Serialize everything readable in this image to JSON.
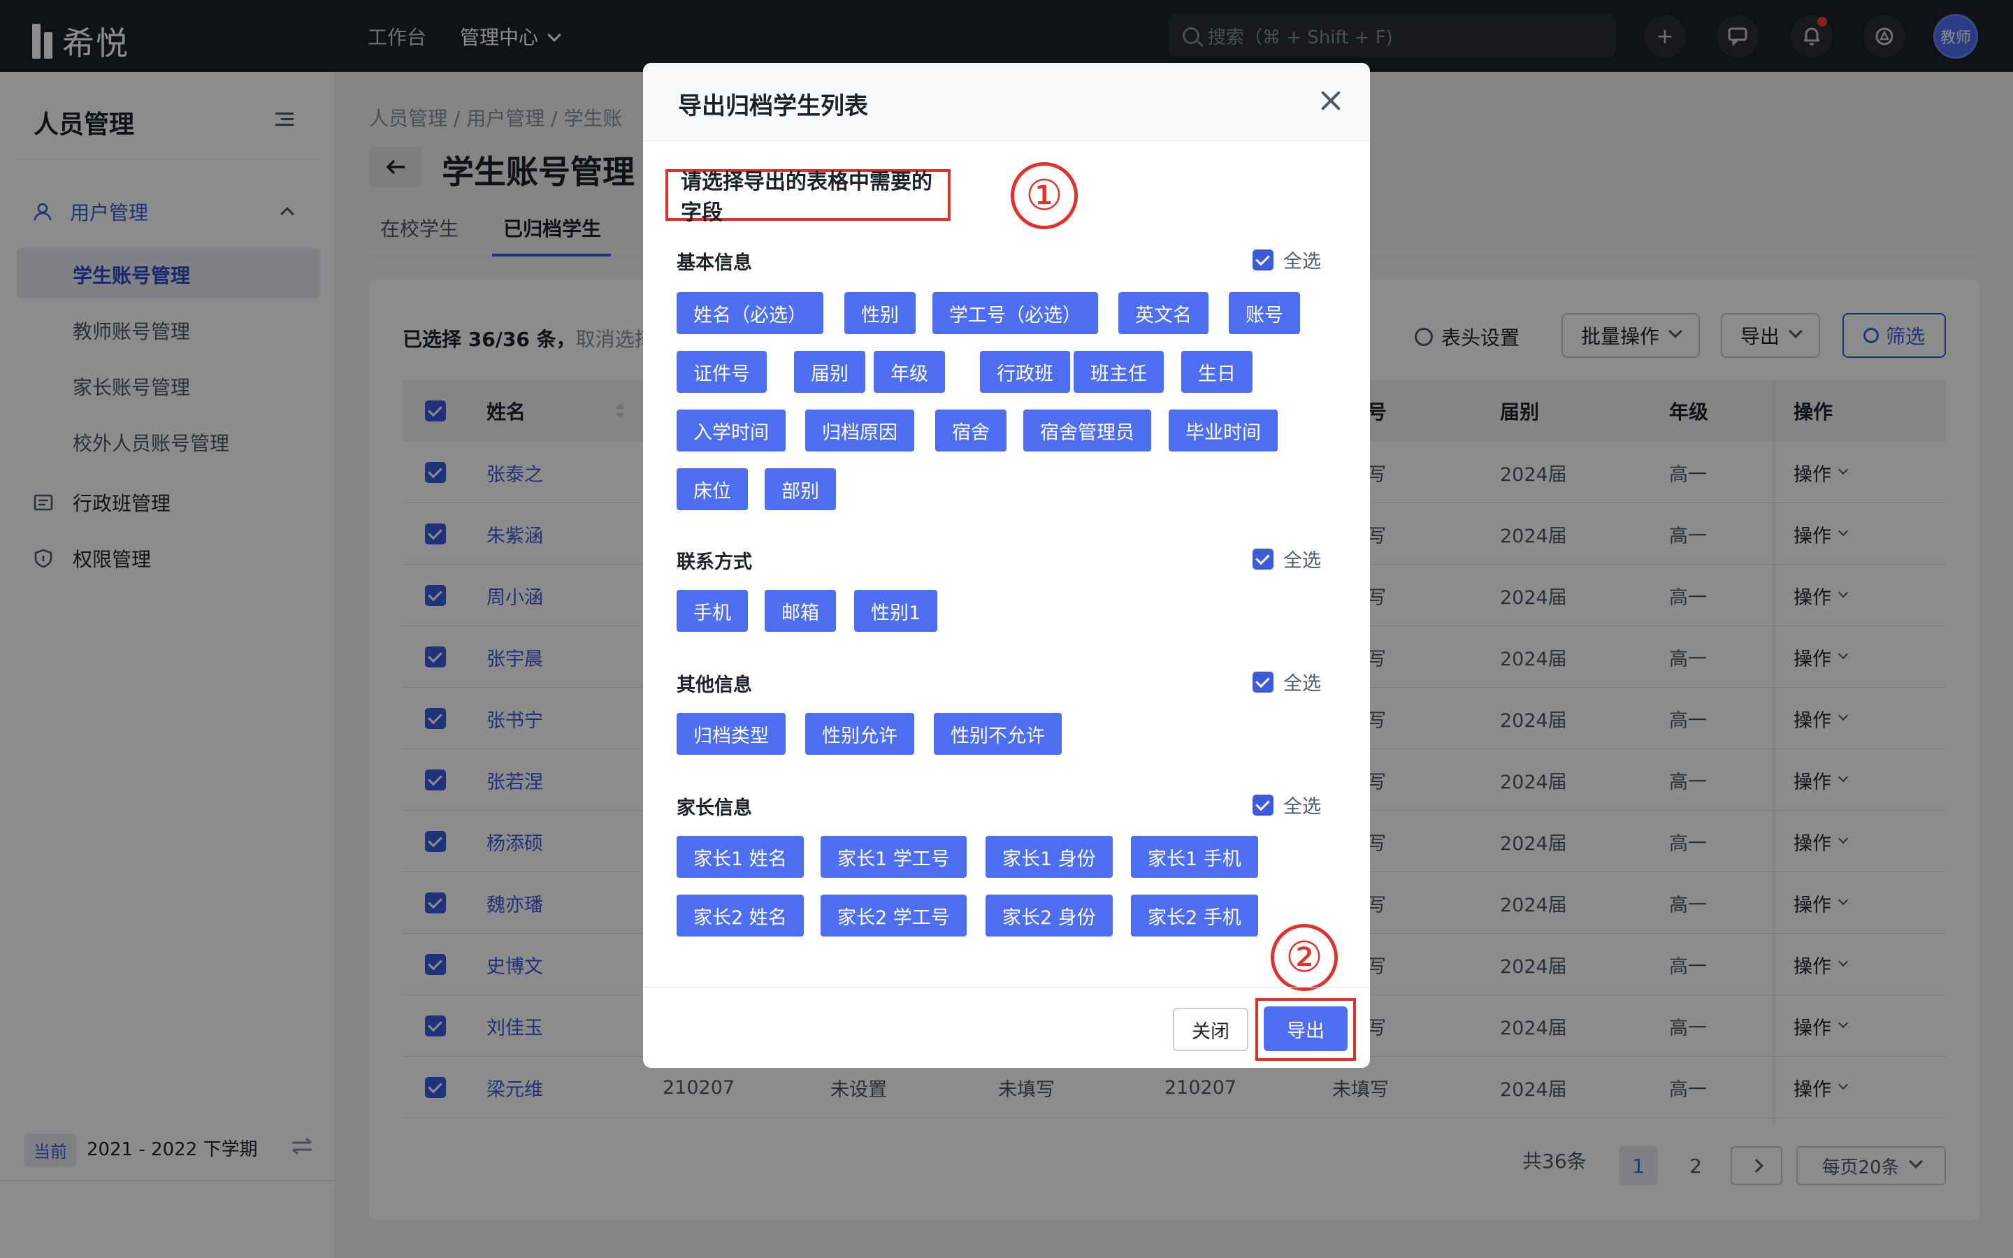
{
  "app": {
    "logo_text": "希悦"
  },
  "topnav": {
    "workbench": "工作台",
    "admin_center": "管理中心"
  },
  "search": {
    "placeholder": "搜索（⌘ + Shift + F)"
  },
  "header": {
    "avatar_label": "教师"
  },
  "sidebar": {
    "title": "人员管理",
    "group_label": "用户管理",
    "items": [
      {
        "label": "学生账号管理",
        "active": true
      },
      {
        "label": "教师账号管理"
      },
      {
        "label": "家长账号管理"
      },
      {
        "label": "校外人员账号管理"
      }
    ],
    "menus": [
      {
        "label": "行政班管理"
      },
      {
        "label": "权限管理"
      }
    ],
    "term_tag": "当前",
    "term": "2021 - 2022 下学期"
  },
  "main": {
    "breadcrumb": "人员管理  /  用户管理  /  学生账",
    "title": "学生账号管理",
    "tabs": [
      {
        "label": "在校学生"
      },
      {
        "label": "已归档学生"
      }
    ],
    "selection": "已选择 36/36 条，",
    "cancel_selection": "取消选择",
    "header_settings": "表头设置",
    "batch_ops": "批量操作",
    "export": "导出",
    "filter": "筛选"
  },
  "table": {
    "headers": {
      "name": "姓名",
      "id": "号",
      "cohort": "届别",
      "grade": "年级",
      "ops": "操作"
    },
    "rows": [
      {
        "name": "张泰之",
        "id_tail": "写",
        "cohort": "2024届",
        "grade": "高一",
        "op": "操作"
      },
      {
        "name": "朱紫涵",
        "id_tail": "写",
        "cohort": "2024届",
        "grade": "高一",
        "op": "操作"
      },
      {
        "name": "周小涵",
        "id_tail": "写",
        "cohort": "2024届",
        "grade": "高一",
        "op": "操作"
      },
      {
        "name": "张宇晨",
        "id_tail": "写",
        "cohort": "2024届",
        "grade": "高一",
        "op": "操作"
      },
      {
        "name": "张书宁",
        "id_tail": "写",
        "cohort": "2024届",
        "grade": "高一",
        "op": "操作"
      },
      {
        "name": "张若涅",
        "id_tail": "写",
        "cohort": "2024届",
        "grade": "高一",
        "op": "操作"
      },
      {
        "name": "杨添硕",
        "id_tail": "写",
        "cohort": "2024届",
        "grade": "高一",
        "op": "操作"
      },
      {
        "name": "魏亦璠",
        "id_tail": "写",
        "cohort": "2024届",
        "grade": "高一",
        "op": "操作"
      },
      {
        "name": "史博文",
        "id_tail": "写",
        "cohort": "2024届",
        "grade": "高一",
        "op": "操作"
      },
      {
        "name": "刘佳玉",
        "id_tail": "写",
        "cohort": "2024届",
        "grade": "高一",
        "op": "操作"
      }
    ],
    "last_row": {
      "name": "梁元维",
      "c1": "210207",
      "c2": "未设置",
      "c3": "未填写",
      "c4": "210207",
      "c5": "未填写",
      "cohort": "2024届",
      "grade": "高一",
      "op": "操作"
    }
  },
  "pager": {
    "total": "共36条",
    "page1": "1",
    "page2": "2",
    "page_size": "每页20条"
  },
  "modal": {
    "title": "导出归档学生列表",
    "instruction": "请选择导出的表格中需要的字段",
    "marker1": "①",
    "marker2": "②",
    "select_all": "全选",
    "sections": {
      "basic": {
        "title": "基本信息",
        "tags": [
          "姓名（必选）",
          "性别",
          "学工号（必选）",
          "英文名",
          "账号",
          "证件号",
          "届别",
          "年级",
          "行政班",
          "班主任",
          "生日",
          "入学时间",
          "归档原因",
          "宿舍",
          "宿舍管理员",
          "毕业时间",
          "床位",
          "部别"
        ]
      },
      "contact": {
        "title": "联系方式",
        "tags": [
          "手机",
          "邮箱",
          "性别1"
        ]
      },
      "other": {
        "title": "其他信息",
        "tags": [
          "归档类型",
          "性别允许",
          "性别不允许"
        ]
      },
      "parent": {
        "title": "家长信息",
        "tags": [
          "家长1 姓名",
          "家长1 学工号",
          "家长1 身份",
          "家长1 手机",
          "家长2 姓名",
          "家长2 学工号",
          "家长2 身份",
          "家长2 手机"
        ]
      }
    },
    "close_label": "关闭",
    "export_label": "导出"
  },
  "colors": {
    "primary": "#4e6ef2",
    "link": "#3b5bdb",
    "annotation": "#e0322c",
    "topbar": "#1d2129"
  }
}
